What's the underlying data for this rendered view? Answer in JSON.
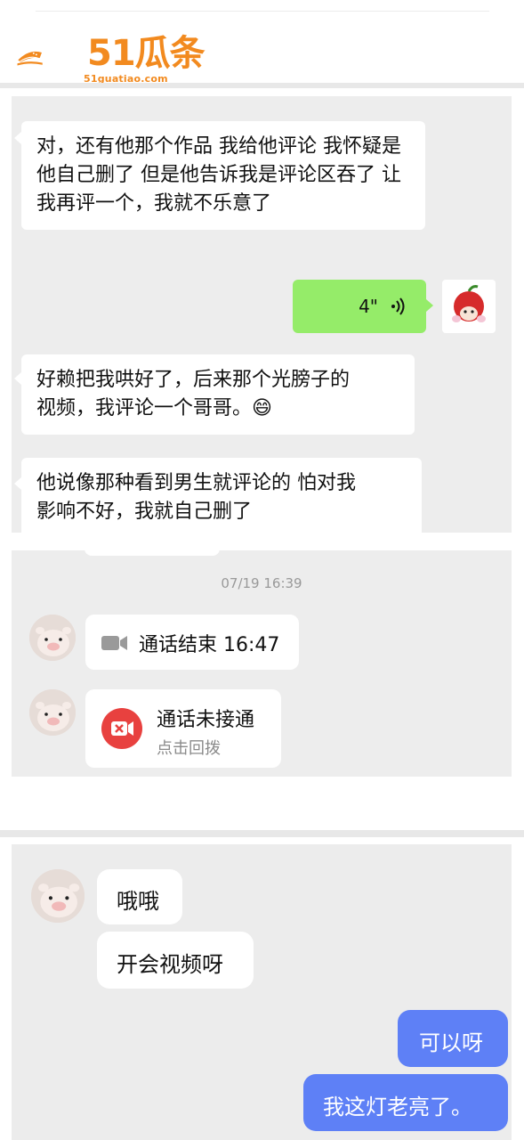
{
  "header": {
    "logo_text": "51瓜条",
    "logo_url": "51guatiao.com",
    "brand_color": "#f28a1f"
  },
  "chat1": {
    "msg1": "对，还有他那个作品 我给他评论  我怀疑是他自己删了  但是他告诉我是评论区吞了 让我再评一个，我就不乐意了",
    "voice_duration": "4\"",
    "msg2_line1": "好赖把我哄好了，后来那个光膀子的",
    "msg2_line2": "视频，我评论一个哥哥。",
    "msg2_emoji": "😄",
    "msg3_line1": "他说像那种看到男生就评论的 怕对我",
    "msg3_line2": "影响不好，我就自己删了",
    "green_color": "#95ec69"
  },
  "chat2": {
    "timestamp": "07/19 16:39",
    "call_ended": "通话结束 16:47",
    "call_missed": "通话未接通",
    "call_back": "点击回拨",
    "missed_color": "#e8413f"
  },
  "chat3": {
    "msg1": "哦哦",
    "msg2": "开会视频呀",
    "msg3": "可以呀",
    "msg4": "我这灯老亮了。",
    "blue_color": "#5e80f6"
  }
}
